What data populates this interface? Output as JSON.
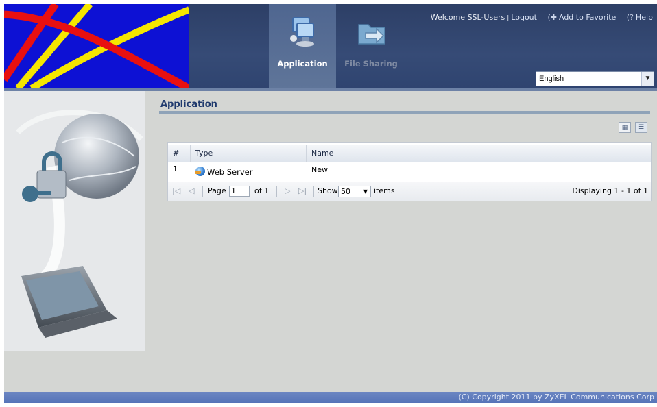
{
  "header": {
    "tabs": [
      {
        "label": "Application",
        "icon": "application-monitor-icon",
        "active": true
      },
      {
        "label": "File Sharing",
        "icon": "file-sharing-icon",
        "active": false
      }
    ],
    "welcome_text": "Welcome SSL-Users",
    "separator": "|",
    "logout_label": "Logout",
    "favorite_label": "Add to Favorite",
    "help_label": "Help",
    "language": {
      "selected": "English"
    }
  },
  "main": {
    "title": "Application",
    "grid": {
      "columns": [
        "#",
        "Type",
        "Name"
      ],
      "rows": [
        {
          "index": "1",
          "type": "Web Server",
          "type_icon": "web-globe-icon",
          "name": "New"
        }
      ],
      "pager": {
        "page_label": "Page",
        "page_value": "1",
        "of_label": "of 1",
        "show_label": "Show",
        "show_value": "50",
        "items_label": "items",
        "displaying": "Displaying 1 - 1 of 1"
      }
    }
  },
  "footer": {
    "copyright": "(C) Copyright 2011 by ZyXEL Communications Corp"
  },
  "colors": {
    "header_bg": "#364b76",
    "logo_bg": "#0d11d4",
    "title_text": "#1f3a6e",
    "footer_bg": "#5f7bbd"
  }
}
